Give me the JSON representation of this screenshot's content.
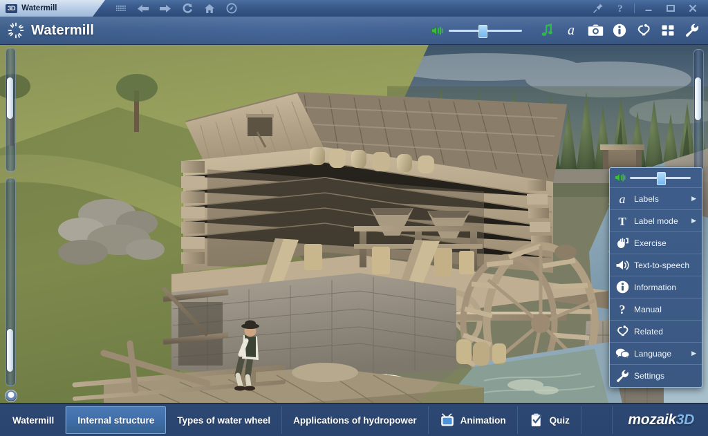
{
  "window": {
    "tab_label": "Watermill",
    "tab_logo": "3D",
    "nav_icons": [
      {
        "name": "grid-dots-icon",
        "glyph": "grid-dots"
      },
      {
        "name": "back-arrow-icon",
        "glyph": "arrow-left"
      },
      {
        "name": "forward-arrow-icon",
        "glyph": "arrow-right"
      },
      {
        "name": "refresh-icon",
        "glyph": "refresh"
      },
      {
        "name": "home-icon",
        "glyph": "home"
      },
      {
        "name": "compass-icon",
        "glyph": "compass"
      }
    ],
    "right_icons": [
      {
        "name": "pin-icon",
        "glyph": "pin"
      },
      {
        "name": "help-icon",
        "glyph": "question"
      }
    ],
    "window_controls": [
      {
        "name": "minimize-button",
        "glyph": "minimize"
      },
      {
        "name": "maximize-button",
        "glyph": "maximize"
      },
      {
        "name": "close-button",
        "glyph": "close"
      }
    ]
  },
  "header": {
    "title": "Watermill",
    "logo_icon": "sunburst-icon",
    "volume": {
      "icon": "volume-icon",
      "value": 45,
      "min": 0,
      "max": 100
    },
    "tools": [
      {
        "name": "music-icon",
        "glyph": "music",
        "label": "Music"
      },
      {
        "name": "labels-icon",
        "glyph": "italic-a",
        "label": "Labels"
      },
      {
        "name": "camera-icon",
        "glyph": "camera",
        "label": "Screenshot"
      },
      {
        "name": "information-icon",
        "glyph": "info",
        "label": "Information"
      },
      {
        "name": "related-icon",
        "glyph": "link",
        "label": "Related"
      },
      {
        "name": "thumbnails-icon",
        "glyph": "grid4",
        "label": "Views"
      },
      {
        "name": "settings-icon",
        "glyph": "wrench",
        "label": "Settings"
      }
    ]
  },
  "scene": {
    "description": "3D rendered watermill with internal structure cutaway, water wheel, millstones, grain sacks and a seated miller beside a stream",
    "left_slider": {
      "name": "zoom-slider",
      "value": 30
    },
    "left_slider2": {
      "name": "pan-slider",
      "value": 78
    },
    "right_slider": {
      "name": "scene-slider",
      "value": 22
    },
    "reset_dot": {
      "name": "reset-view-button"
    }
  },
  "context_menu": {
    "volume": {
      "icon": "volume-icon",
      "value": 50
    },
    "items": [
      {
        "label": "Labels",
        "icon": "italic-a",
        "icon_name": "labels-icon",
        "arrow": true
      },
      {
        "label": "Label mode",
        "icon": "serif-t",
        "icon_name": "label-mode-icon",
        "arrow": true
      },
      {
        "label": "Exercise",
        "icon": "hand",
        "icon_name": "exercise-icon",
        "arrow": false
      },
      {
        "label": "Text-to-speech",
        "icon": "speaker",
        "icon_name": "text-to-speech-icon",
        "arrow": false
      },
      {
        "label": "Information",
        "icon": "info",
        "icon_name": "information-icon",
        "arrow": false
      },
      {
        "label": "Manual",
        "icon": "question",
        "icon_name": "manual-icon",
        "arrow": false
      },
      {
        "label": "Related",
        "icon": "link",
        "icon_name": "related-icon",
        "arrow": false
      },
      {
        "label": "Language",
        "icon": "speech",
        "icon_name": "language-icon",
        "arrow": true
      },
      {
        "label": "Settings",
        "icon": "wrench",
        "icon_name": "settings-icon",
        "arrow": false
      }
    ],
    "arrow_glyph": "▶"
  },
  "tabs": [
    {
      "label": "Watermill",
      "active": false,
      "icon": null
    },
    {
      "label": "Internal structure",
      "active": true,
      "icon": null
    },
    {
      "label": "Types of water wheel",
      "active": false,
      "icon": null
    },
    {
      "label": "Applications of hydropower",
      "active": false,
      "icon": null
    },
    {
      "label": "Animation",
      "active": false,
      "icon": "tv",
      "icon_name": "animation-icon"
    },
    {
      "label": "Quiz",
      "active": false,
      "icon": "clipboard",
      "icon_name": "quiz-icon"
    }
  ],
  "brand": {
    "part1": "mozaik",
    "part2": "3D"
  },
  "colors": {
    "header_blue": "#46679a",
    "panel_blue": "#3e5d8a",
    "tabbar_blue": "#2a4570",
    "active_tab": "#3f6da8",
    "accent_light": "#7fb4e8",
    "volume_green": "#3dbb3d"
  }
}
